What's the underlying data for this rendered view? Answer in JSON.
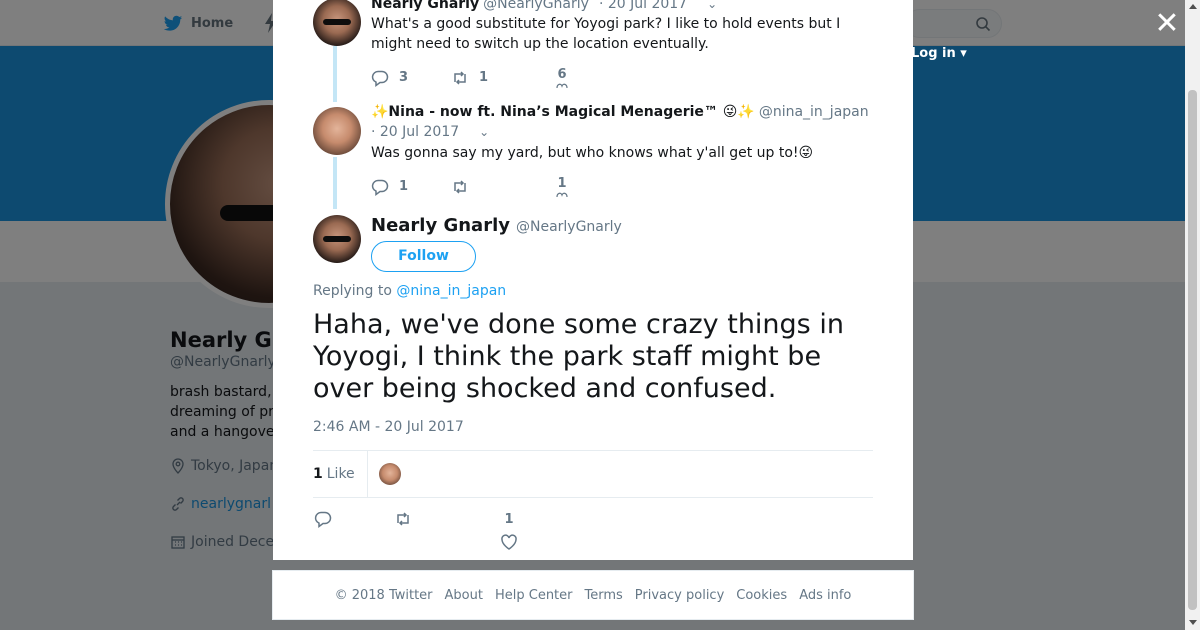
{
  "background": {
    "nav_home": "Home",
    "login": "Log in",
    "profile_name": "Nearly G",
    "profile_handle": "@NearlyGnarly",
    "bio_lines": [
      "brash bastard,",
      "dreaming of pr",
      "and a hangove"
    ],
    "location": "Tokyo, Japan",
    "website": "nearlygnarl",
    "joined": "Joined Dece",
    "banner_color": "#1b95e0"
  },
  "thread": [
    {
      "name": "Nearly Gnarly",
      "handle": "@NearlyGnarly",
      "date": "· 20 Jul 2017",
      "text_lines": [
        "What's a good substitute for Yoyogi park? I like to hold events but I",
        "might need to switch up the location eventually."
      ],
      "replies": "3",
      "retweets": "1",
      "likes": "6"
    },
    {
      "name": "✨Nina - now ft. Nina’s Magical Menagerie™ 😜✨",
      "handle": "@nina_in_japan",
      "date": "· 20 Jul 2017",
      "text": "Was gonna say my yard, but who knows what y'all get up to!😜",
      "replies": "1",
      "retweets": "",
      "likes": "1"
    }
  ],
  "main_tweet": {
    "name": "Nearly Gnarly",
    "handle": "@NearlyGnarly",
    "follow_label": "Follow",
    "replying_prefix": "Replying to",
    "replying_to": "@nina_in_japan",
    "text": "Haha, we've done some crazy things in Yoyogi, I think the park staff might be over being shocked and confused.",
    "timestamp": "2:46 AM - 20 Jul 2017",
    "like_count": "1",
    "like_label": "Like",
    "like_action_count": "1"
  },
  "footer": {
    "copyright": "© 2018 Twitter",
    "links": [
      "About",
      "Help Center",
      "Terms",
      "Privacy policy",
      "Cookies",
      "Ads info"
    ]
  },
  "colors": {
    "accent": "#1da1f2",
    "thread_line": "#c4e6f6",
    "muted": "#657786"
  }
}
